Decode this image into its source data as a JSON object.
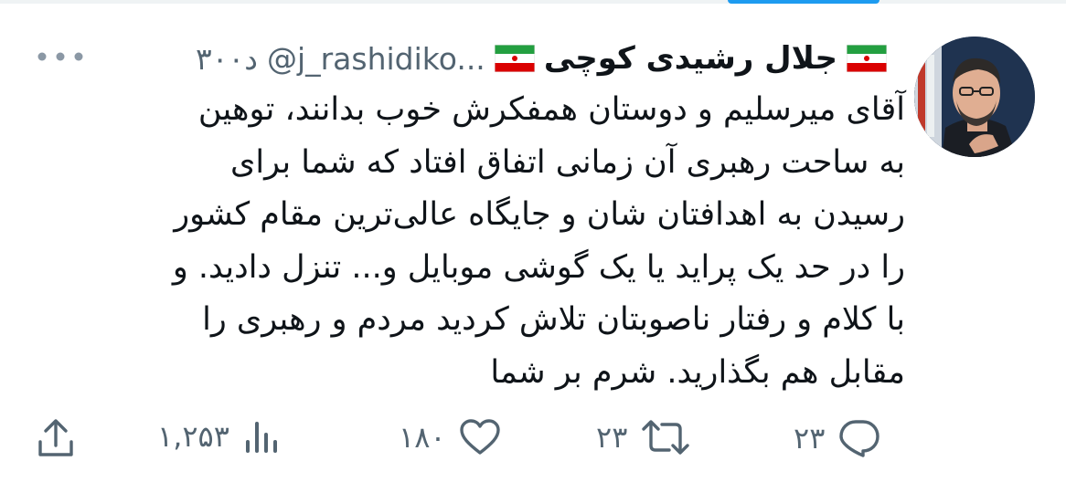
{
  "tweet": {
    "display_name": "جلال رشیدی کوچی",
    "handle": "@j_rashidiko...",
    "time": "۳۰۰د",
    "text": "آقای میرسلیم و دوستان همفکرش خوب بدانند، توهین\nبه ساحت رهبری آن زمانی اتفاق افتاد که شما برای\nرسیدن به اهدافتان شان و جایگاه عالی‌ترین مقام کشور\nرا در حد یک پراید یا یک گوشی موبایل و... تنزل دادید. و\nبا کلام و رفتار ناصوبتان تلاش کردید مردم و رهبری را\nمقابل هم بگذارید. شرم بر شما"
  },
  "actions": {
    "reply_count": "۲۳",
    "retweet_count": "۲۳",
    "like_count": "۱۸۰",
    "views_count": "۱,۲۵۳"
  },
  "icons": {
    "more": "more-dots-icon",
    "reply": "reply-bubble-icon",
    "retweet": "retweet-arrows-icon",
    "like": "heart-icon",
    "views": "bar-chart-icon",
    "share": "share-upload-icon",
    "flag": "iran-flag-emoji"
  },
  "colors": {
    "text": "#0f1419",
    "secondary": "#536471",
    "accent": "#1d9bf0"
  }
}
